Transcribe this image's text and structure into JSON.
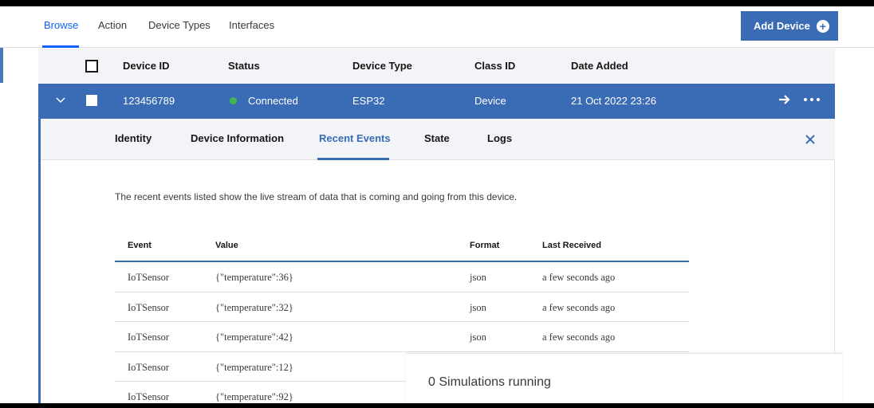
{
  "nav": {
    "tabs": [
      {
        "label": "Browse"
      },
      {
        "label": "Action"
      },
      {
        "label": "Device Types"
      },
      {
        "label": "Interfaces"
      }
    ],
    "add_device_label": "Add Device"
  },
  "table": {
    "columns": [
      "Device ID",
      "Status",
      "Device Type",
      "Class ID",
      "Date Added"
    ],
    "row": {
      "device_id": "123456789",
      "status": "Connected",
      "device_type": "ESP32",
      "class_id": "Device",
      "date_added": "21 Oct 2022 23:26"
    },
    "status_color": "#3fb950"
  },
  "details": {
    "tabs": [
      "Identity",
      "Device Information",
      "Recent Events",
      "State",
      "Logs"
    ],
    "active_tab": "Recent Events",
    "description": "The recent events listed show the live stream of data that is coming and going from this device.",
    "events": {
      "columns": [
        "Event",
        "Value",
        "Format",
        "Last Received"
      ],
      "rows": [
        {
          "event": "IoTSensor",
          "value": "{\"temperature\":36}",
          "format": "json",
          "last": "a few seconds ago"
        },
        {
          "event": "IoTSensor",
          "value": "{\"temperature\":32}",
          "format": "json",
          "last": "a few seconds ago"
        },
        {
          "event": "IoTSensor",
          "value": "{\"temperature\":42}",
          "format": "json",
          "last": "a few seconds ago"
        },
        {
          "event": "IoTSensor",
          "value": "{\"temperature\":12}",
          "format": "",
          "last": ""
        },
        {
          "event": "IoTSensor",
          "value": "{\"temperature\":92}",
          "format": "",
          "last": ""
        }
      ]
    }
  },
  "simulations": {
    "text": "0 Simulations running"
  },
  "colors": {
    "accent": "#3a6cb6",
    "link": "#0f62fe"
  }
}
